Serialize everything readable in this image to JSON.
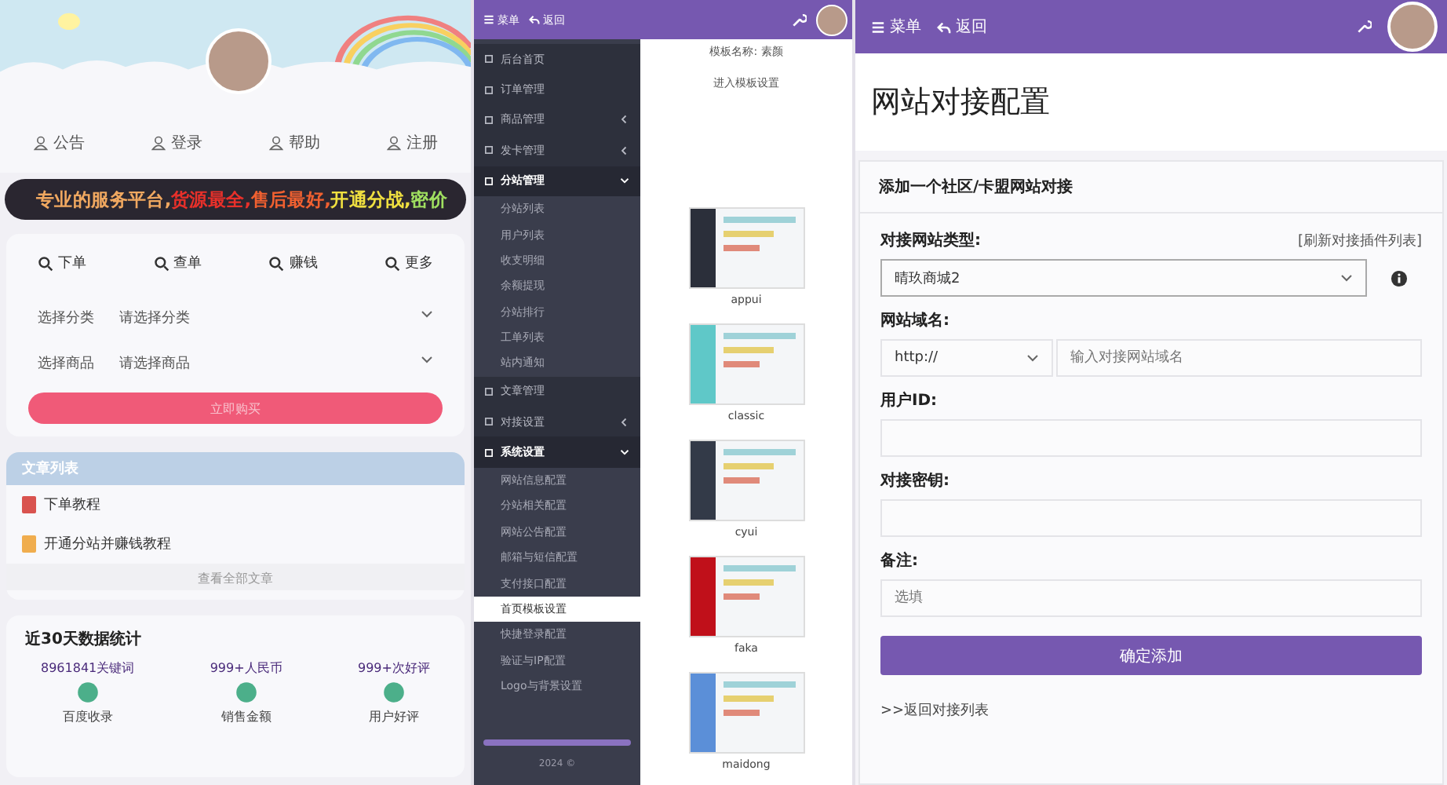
{
  "home": {
    "nav": [
      {
        "label": "公告"
      },
      {
        "label": "登录"
      },
      {
        "label": "帮助"
      },
      {
        "label": "注册"
      }
    ],
    "marquee": [
      {
        "text": "专业的服务平台,",
        "color": "#f0a860"
      },
      {
        "text": "货源最全,",
        "color": "#e8302a"
      },
      {
        "text": "售后最好,",
        "color": "#f06030"
      },
      {
        "text": "开通分战,",
        "color": "#f0e040"
      },
      {
        "text": "密价",
        "color": "#a0e060"
      }
    ],
    "tabs": [
      {
        "label": "下单"
      },
      {
        "label": "查单"
      },
      {
        "label": "赚钱"
      },
      {
        "label": "更多"
      }
    ],
    "selects": [
      {
        "label": "选择分类",
        "placeholder": "请选择分类"
      },
      {
        "label": "选择商品",
        "placeholder": "请选择商品"
      }
    ],
    "buy_button": "立即购买",
    "articles": {
      "title": "文章列表",
      "items": [
        {
          "title": "下单教程",
          "color": "#d9534f"
        },
        {
          "title": "开通分站并赚钱教程",
          "color": "#f0ad4e"
        }
      ],
      "more": "查看全部文章"
    },
    "stats": {
      "title": "近30天数据统计",
      "items": [
        {
          "value": "8961841关键词",
          "label": "百度收录"
        },
        {
          "value": "999+人民币",
          "label": "销售金额"
        },
        {
          "value": "999+次好评",
          "label": "用户好评"
        }
      ]
    }
  },
  "admin": {
    "topbar": {
      "menu": "菜单",
      "back": "返回"
    },
    "sidebar": [
      {
        "label": "后台首页",
        "kind": "link",
        "expanded": false
      },
      {
        "label": "订单管理",
        "kind": "link",
        "expanded": false
      },
      {
        "label": "商品管理",
        "kind": "group",
        "expanded": false
      },
      {
        "label": "发卡管理",
        "kind": "group",
        "expanded": false
      },
      {
        "label": "分站管理",
        "kind": "group",
        "expanded": true,
        "children": [
          {
            "label": "分站列表",
            "selected": false
          },
          {
            "label": "用户列表",
            "selected": false
          },
          {
            "label": "收支明细",
            "selected": false
          },
          {
            "label": "余额提现",
            "selected": false
          },
          {
            "label": "分站排行",
            "selected": false
          },
          {
            "label": "工单列表",
            "selected": false
          },
          {
            "label": "站内通知",
            "selected": false
          }
        ]
      },
      {
        "label": "文章管理",
        "kind": "link",
        "expanded": false
      },
      {
        "label": "对接设置",
        "kind": "group",
        "expanded": false
      },
      {
        "label": "系统设置",
        "kind": "group",
        "expanded": true,
        "children": [
          {
            "label": "网站信息配置",
            "selected": false
          },
          {
            "label": "分站相关配置",
            "selected": false
          },
          {
            "label": "网站公告配置",
            "selected": false
          },
          {
            "label": "邮箱与短信配置",
            "selected": false
          },
          {
            "label": "支付接口配置",
            "selected": false
          },
          {
            "label": "首页模板设置",
            "selected": true
          },
          {
            "label": "快捷登录配置",
            "selected": false
          },
          {
            "label": "验证与IP配置",
            "selected": false
          },
          {
            "label": "Logo与背景设置",
            "selected": false
          }
        ]
      }
    ],
    "footer": "2024 ©",
    "template": {
      "name_label": "模板名称: 素颜",
      "settings_link": "进入模板设置",
      "templates": [
        {
          "name": "appui"
        },
        {
          "name": "classic"
        },
        {
          "name": "cyui"
        },
        {
          "name": "faka"
        },
        {
          "name": "maidong"
        }
      ]
    }
  },
  "config": {
    "topbar": {
      "menu": "菜单",
      "back": "返回"
    },
    "title": "网站对接配置",
    "section_title": "添加一个社区/卡盟网站对接",
    "fields": [
      {
        "kind": "select",
        "label": "对接网站类型:",
        "value": "晴玖商城2",
        "link": "[刷新对接插件列表]"
      },
      {
        "kind": "url",
        "label": "网站域名:",
        "scheme": "http://",
        "placeholder": "输入对接网站域名"
      },
      {
        "kind": "text",
        "label": "用户ID:"
      },
      {
        "kind": "text",
        "label": "对接密钥:"
      },
      {
        "kind": "text",
        "label": "备注:",
        "placeholder": "选填"
      }
    ],
    "submit": "确定添加",
    "back_link": ">>返回对接列表"
  }
}
